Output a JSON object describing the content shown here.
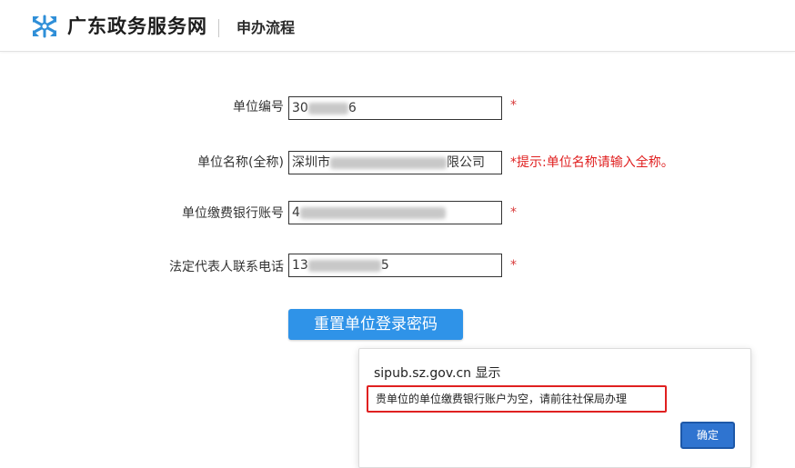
{
  "header": {
    "site_title": "广东政务服务网",
    "section": "申办流程",
    "logo_icon": "snowflake-logo-icon"
  },
  "form": {
    "fields": [
      {
        "label": "单位编号",
        "value_visible": "30",
        "value_tail": "6",
        "marker": "*"
      },
      {
        "label": "单位名称(全称)",
        "value_visible": "深圳市",
        "value_tail": "限公司",
        "hint": "*提示:单位名称请输入全称。"
      },
      {
        "label": "单位缴费银行账号",
        "value_visible": "4",
        "value_tail": "",
        "marker": "*"
      },
      {
        "label": "法定代表人联系电话",
        "value_visible": "13",
        "value_tail": "5",
        "marker": "*"
      }
    ],
    "submit_label": "重置单位登录密码"
  },
  "dialog": {
    "title": "sipub.sz.gov.cn 显示",
    "message": "贵单位的单位缴费银行账户为空，请前往社保局办理",
    "ok_label": "确定"
  },
  "colors": {
    "primary_button": "#2f93e8",
    "required_marker": "#d83a3a",
    "hint_text": "#e02020",
    "dialog_ok": "#2f74d0"
  }
}
